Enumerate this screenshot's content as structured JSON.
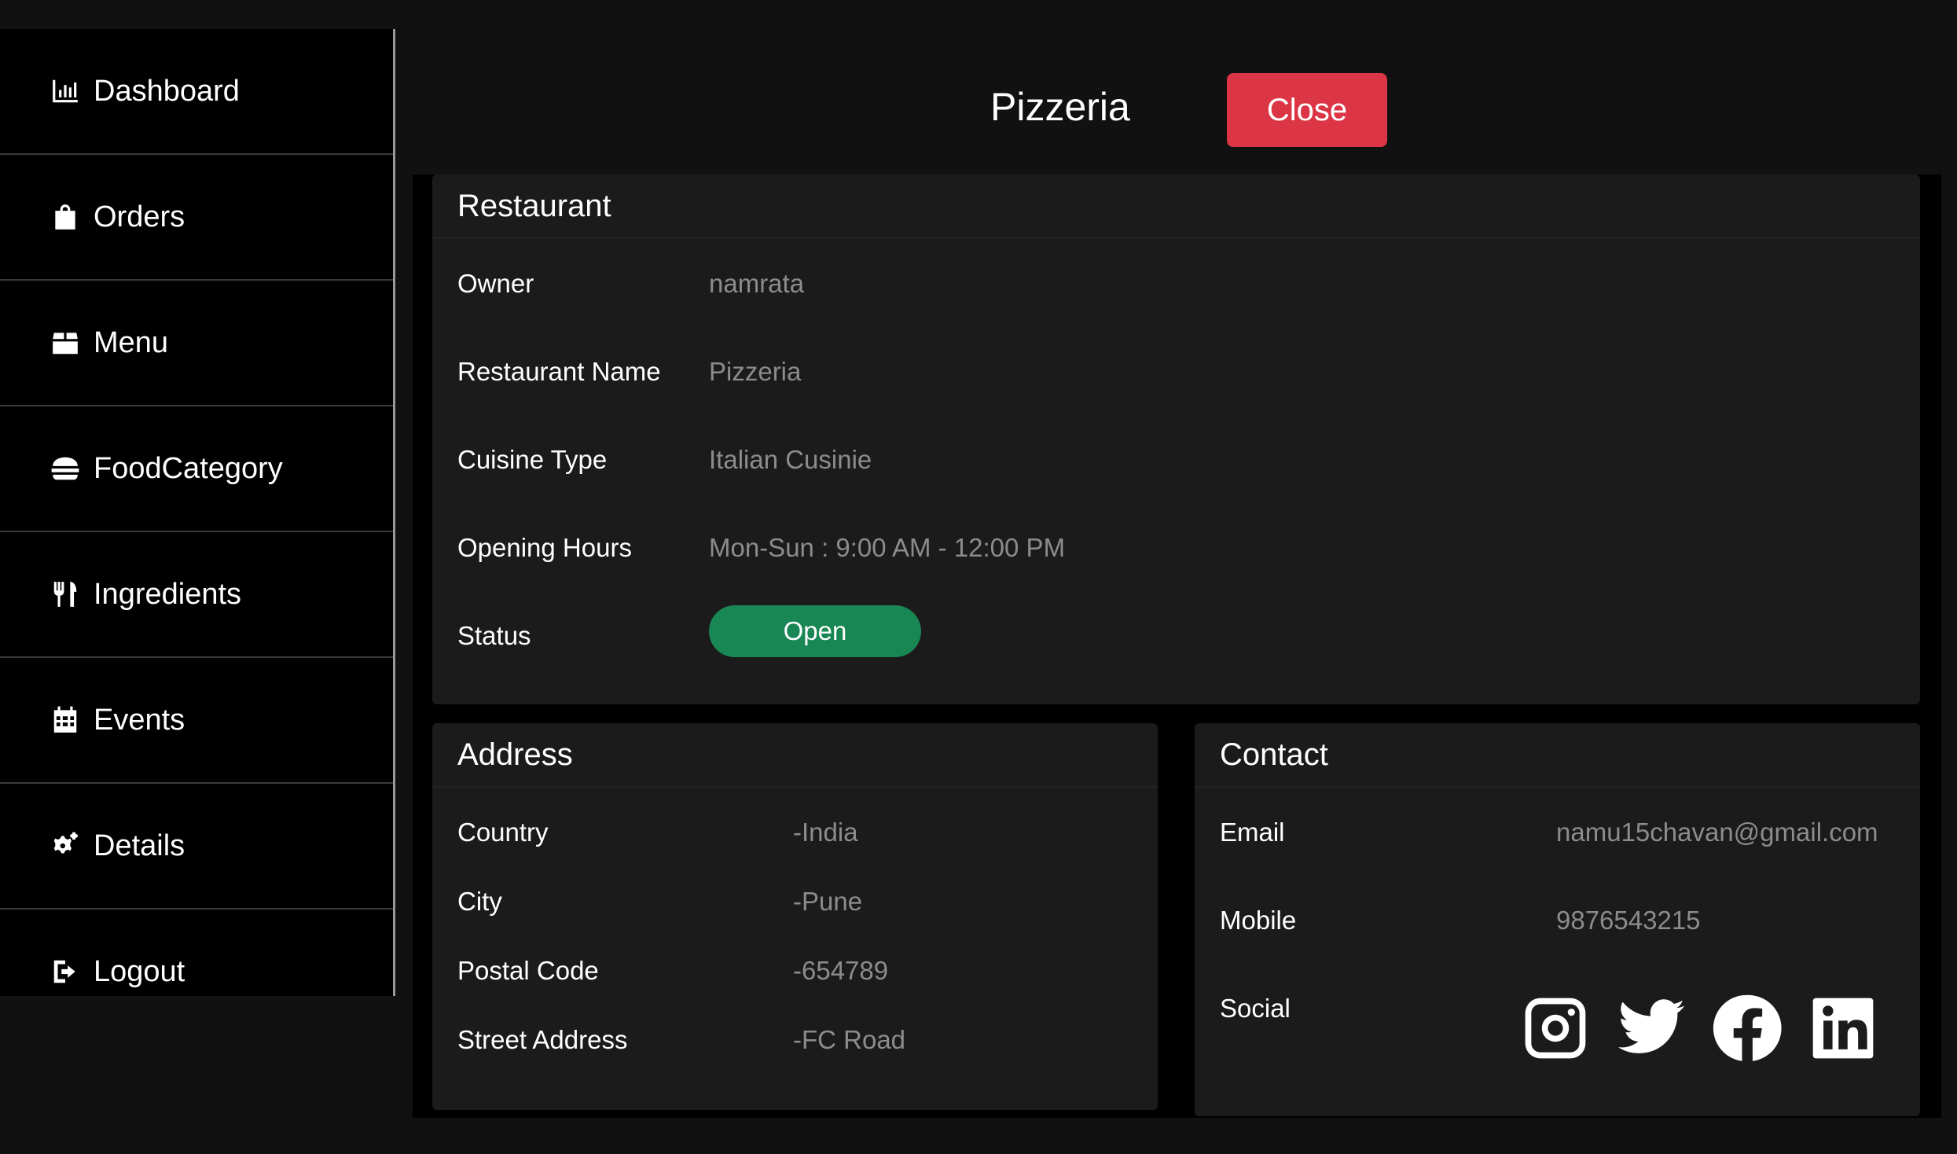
{
  "sidebar": {
    "items": [
      {
        "label": "Dashboard",
        "icon": "chart-bar-icon"
      },
      {
        "label": "Orders",
        "icon": "shopping-bag-icon"
      },
      {
        "label": "Menu",
        "icon": "box-icon"
      },
      {
        "label": "FoodCategory",
        "icon": "burger-icon"
      },
      {
        "label": "Ingredients",
        "icon": "utensils-icon"
      },
      {
        "label": "Events",
        "icon": "calendar-icon"
      },
      {
        "label": "Details",
        "icon": "gears-icon"
      },
      {
        "label": "Logout",
        "icon": "logout-icon"
      }
    ]
  },
  "header": {
    "title": "Pizzeria",
    "close_label": "Close"
  },
  "restaurant": {
    "heading": "Restaurant",
    "owner_label": "Owner",
    "owner_value": "namrata",
    "name_label": "Restaurant Name",
    "name_value": "Pizzeria",
    "cuisine_label": "Cuisine Type",
    "cuisine_value": "Italian Cusinie",
    "hours_label": "Opening Hours",
    "hours_value": "Mon-Sun : 9:00 AM - 12:00 PM",
    "status_label": "Status",
    "status_value": "Open"
  },
  "address": {
    "heading": "Address",
    "country_label": "Country",
    "country_value": "-India",
    "city_label": "City",
    "city_value": "-Pune",
    "postal_label": "Postal Code",
    "postal_value": "-654789",
    "street_label": "Street Address",
    "street_value": "-FC Road"
  },
  "contact": {
    "heading": "Contact",
    "email_label": "Email",
    "email_value": "namu15chavan@gmail.com",
    "mobile_label": "Mobile",
    "mobile_value": "9876543215",
    "social_label": "Social",
    "social_icons": [
      "instagram-icon",
      "twitter-icon",
      "facebook-icon",
      "linkedin-icon"
    ]
  },
  "colors": {
    "close_button": "#dc3545",
    "status_open": "#198754",
    "value_text": "#8c8c8c"
  }
}
